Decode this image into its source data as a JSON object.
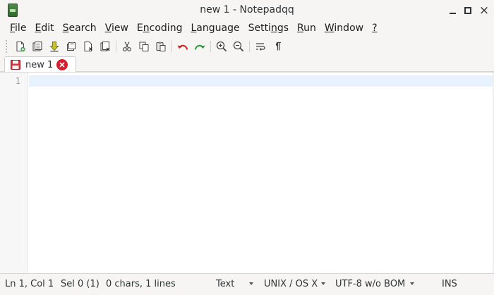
{
  "window": {
    "title": "new 1 - Notepadqq",
    "close_glyph": "×"
  },
  "menu": [
    {
      "label": "File",
      "mnemonic": "F",
      "rest": "ile"
    },
    {
      "label": "Edit",
      "mnemonic": "E",
      "rest": "dit"
    },
    {
      "label": "Search",
      "mnemonic": "S",
      "rest": "earch"
    },
    {
      "label": "View",
      "mnemonic": "V",
      "rest": "iew"
    },
    {
      "label": "Encoding",
      "mnemonic_pre": "E",
      "mnemonic": "n",
      "rest": "coding"
    },
    {
      "label": "Language",
      "mnemonic": "L",
      "rest": "anguage"
    },
    {
      "label": "Settings",
      "mnemonic_pre": "Setti",
      "mnemonic": "n",
      "rest": "gs"
    },
    {
      "label": "Run",
      "mnemonic": "R",
      "rest": "un"
    },
    {
      "label": "Window",
      "mnemonic": "W",
      "rest": "indow"
    },
    {
      "label": "?",
      "mnemonic": "?",
      "rest": ""
    }
  ],
  "toolbar": {
    "icons": [
      "new-file-icon",
      "open-file-icon",
      "reload-icon",
      "save-icon",
      "close-file-icon",
      "close-all-icon",
      "cut-icon",
      "copy-icon",
      "paste-icon",
      "undo-icon",
      "redo-icon",
      "zoom-in-icon",
      "zoom-out-icon",
      "word-wrap-icon",
      "show-all-chars-icon"
    ]
  },
  "tab": {
    "label": "new 1"
  },
  "editor": {
    "line_numbers": [
      "1"
    ],
    "content": ""
  },
  "status": {
    "position": "Ln 1, Col 1",
    "selection": "Sel 0 (1)",
    "counts": "0 chars, 1 lines",
    "language": "Text",
    "eol": "UNIX / OS X",
    "encoding": "UTF-8 w/o BOM",
    "mode": "INS"
  },
  "colors": {
    "tab_close": "#d71d2e",
    "current_line": "#e8f2fe",
    "undo_arrow": "#d01c1c",
    "redo_arrow": "#2a9a3a"
  }
}
